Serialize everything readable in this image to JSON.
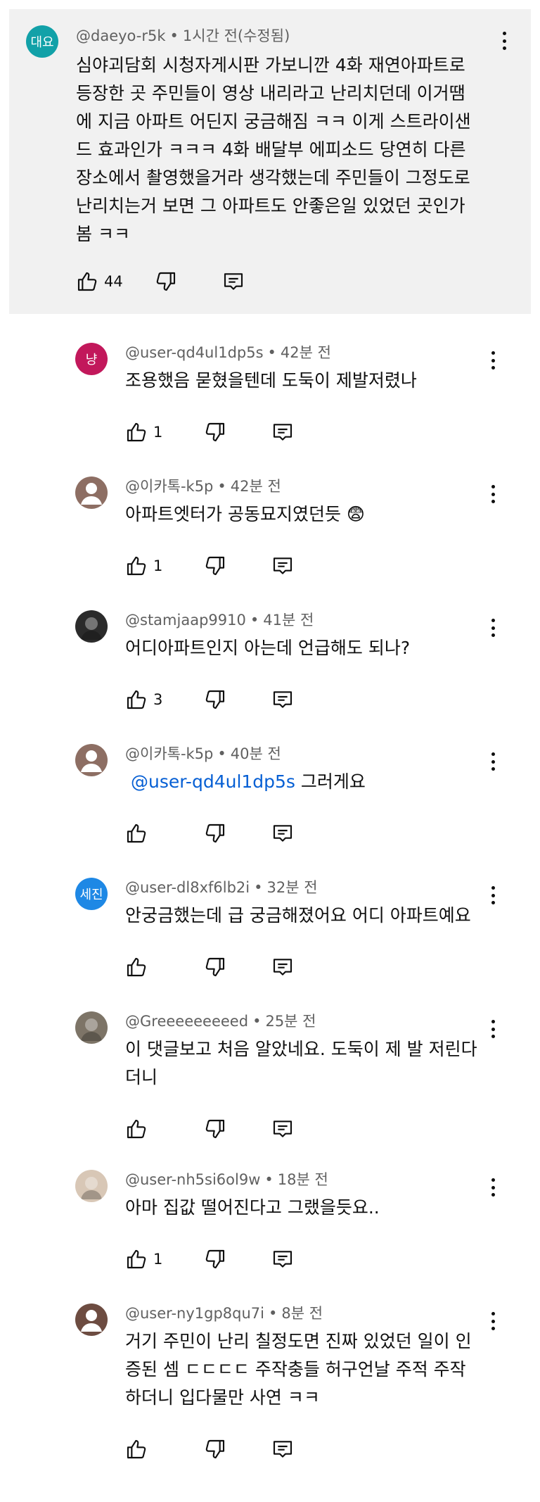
{
  "main": {
    "avatar_text": "대요",
    "avatar_color": "#12a1a8",
    "handle": "@daeyo-r5k",
    "time": "1시간 전(수정됨)",
    "lines": [
      "심야괴담회 시청자게시판 가보니깐 4화 재연아파트로",
      "등장한 곳 주민들이 영상 내리라고 난리치던데 이거땜",
      "에 지금 아파트 어딘지 궁금해짐 ㅋㅋ 이게 스트라이샌",
      "드 효과인가 ㅋㅋㅋ 4화 배달부 에피소드 당연히 다른",
      "장소에서 촬영했을거라 생각했는데 주민들이 그정도로",
      "난리치는거 보면 그 아파트도 안좋은일 있었던 곳인가",
      "봄 ㅋㅋ"
    ],
    "likes": "44"
  },
  "separator": "•",
  "replies": [
    {
      "avatar_type": "text",
      "avatar_text": "냥",
      "avatar_color": "#c2185b",
      "handle": "@user-qd4ul1dp5s",
      "time": "42분 전",
      "mention": "",
      "lines": [
        "조용했음 묻혔을텐데 도둑이 제발저렸나"
      ],
      "likes": "1"
    },
    {
      "avatar_type": "person",
      "avatar_text": "",
      "avatar_color": "#8d6e63",
      "handle": "@이카톡-k5p",
      "time": "42분 전",
      "mention": "",
      "lines": [
        "아파트엣터가 공동묘지였던듯 😨"
      ],
      "likes": "1"
    },
    {
      "avatar_type": "photo",
      "avatar_text": "",
      "avatar_color": "#2b2b2b",
      "handle": "@stamjaap9910",
      "time": "41분 전",
      "mention": "",
      "lines": [
        "어디아파트인지 아는데 언급해도 되나?"
      ],
      "likes": "3"
    },
    {
      "avatar_type": "person",
      "avatar_text": "",
      "avatar_color": "#8d6e63",
      "handle": "@이카톡-k5p",
      "time": "40분 전",
      "mention": "@user-qd4ul1dp5s",
      "lines": [
        "그러게요"
      ],
      "likes": ""
    },
    {
      "avatar_type": "text",
      "avatar_text": "세진",
      "avatar_color": "#1e88e5",
      "handle": "@user-dl8xf6lb2i",
      "time": "32분 전",
      "mention": "",
      "lines": [
        "안궁금했는데 급 궁금해졌어요  어디 아파트예요"
      ],
      "likes": ""
    },
    {
      "avatar_type": "photo",
      "avatar_text": "",
      "avatar_color": "#7d7467",
      "handle": "@Greeeeeeeeed",
      "time": "25분 전",
      "mention": "",
      "lines": [
        "이 댓글보고 처음 알았네요. 도둑이 제 발 저린다",
        "더니"
      ],
      "likes": ""
    },
    {
      "avatar_type": "photo",
      "avatar_text": "",
      "avatar_color": "#d8c7b6",
      "handle": "@user-nh5si6ol9w",
      "time": "18분 전",
      "mention": "",
      "lines": [
        "아마 집값 떨어진다고 그랬을듯요.."
      ],
      "likes": "1"
    },
    {
      "avatar_type": "person",
      "avatar_text": "",
      "avatar_color": "#6d4c41",
      "handle": "@user-ny1gp8qu7i",
      "time": "8분 전",
      "mention": "",
      "lines": [
        "거기 주민이 난리 칠정도면 진짜 있었던 일이 인",
        "증된 셈 ㄷㄷㄷㄷ 주작충들 허구언날 주적 주작",
        "하더니 입다물만 사연 ㅋㅋ"
      ],
      "likes": ""
    }
  ]
}
